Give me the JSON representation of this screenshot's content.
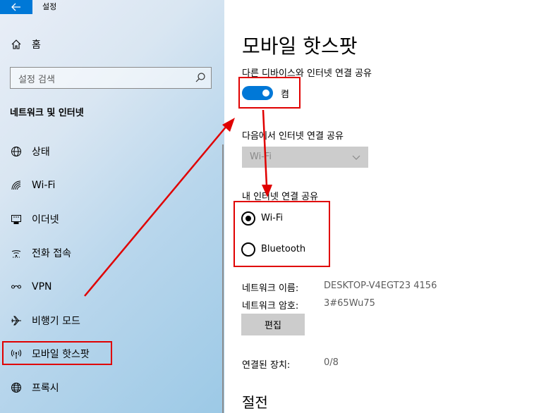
{
  "window": {
    "title": "설정",
    "back_icon": "back-arrow-icon"
  },
  "sidebar": {
    "home": "홈",
    "search_placeholder": "설정 검색",
    "section_title": "네트워크 및 인터넷",
    "items": [
      {
        "label": "상태",
        "icon": "globe-status-icon"
      },
      {
        "label": "Wi-Fi",
        "icon": "wifi-icon"
      },
      {
        "label": "이더넷",
        "icon": "ethernet-icon"
      },
      {
        "label": "전화 접속",
        "icon": "dialup-icon"
      },
      {
        "label": "VPN",
        "icon": "vpn-icon"
      },
      {
        "label": "비행기 모드",
        "icon": "airplane-icon"
      },
      {
        "label": "모바일 핫스팟",
        "icon": "hotspot-icon",
        "selected": true
      },
      {
        "label": "프록시",
        "icon": "globe-icon"
      }
    ]
  },
  "main": {
    "title": "모바일 핫스팟",
    "share_label": "다른 디바이스와 인터넷 연결 공유",
    "toggle": {
      "state_label": "켬",
      "on": true
    },
    "share_from_label": "다음에서 인터넷 연결 공유",
    "share_from_value": "Wi-Fi",
    "share_over_label": "내 인터넷 연결 공유",
    "radio_options": [
      {
        "label": "Wi-Fi",
        "checked": true
      },
      {
        "label": "Bluetooth",
        "checked": false
      }
    ],
    "network_name_label": "네트워크 이름:",
    "network_name_value": "DESKTOP-V4EGT23 4156",
    "network_password_label": "네트워크 암호:",
    "network_password_value": "3#65Wu75",
    "edit_button": "편집",
    "connected_devices_label": "연결된 장치:",
    "connected_devices_value": "0/8",
    "power_saving_title": "절전"
  },
  "colors": {
    "accent": "#0078d7",
    "annotation": "#e00000"
  }
}
